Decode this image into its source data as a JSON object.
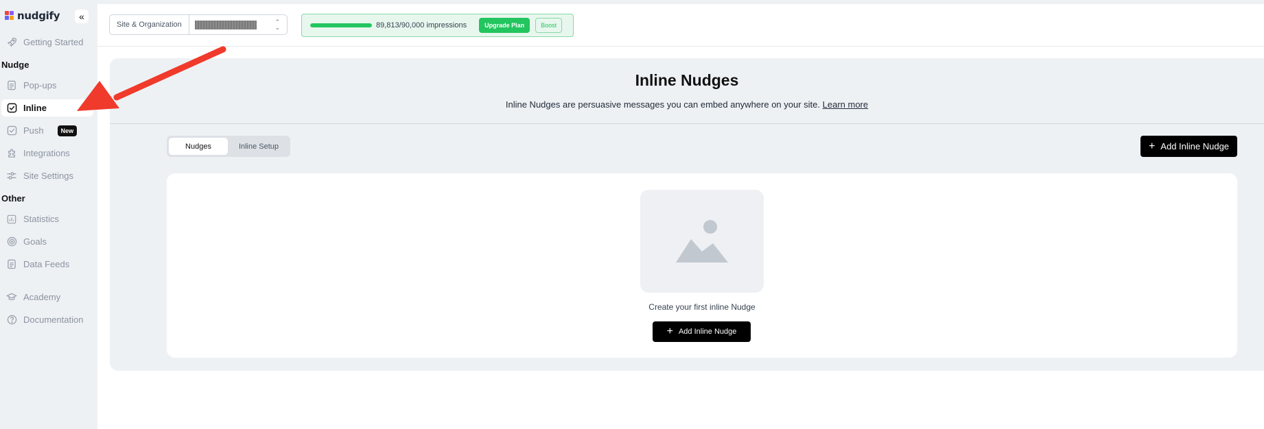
{
  "brand": {
    "name": "nudgify",
    "collapse_icon": "«"
  },
  "sidebar": {
    "getting_started": "Getting Started",
    "section_nudge": "Nudge",
    "popups": "Pop-ups",
    "inline": "Inline",
    "push": "Push",
    "push_badge": "New",
    "integrations": "Integrations",
    "site_settings": "Site Settings",
    "section_other": "Other",
    "statistics": "Statistics",
    "goals": "Goals",
    "data_feeds": "Data Feeds",
    "academy": "Academy",
    "documentation": "Documentation"
  },
  "topbar": {
    "site_select_label": "Site & Organization",
    "impressions_text": "89,813/90,000 impressions",
    "impressions_used": 89813,
    "impressions_limit": 90000,
    "upgrade_label": "Upgrade Plan",
    "boost_label": "Boost"
  },
  "main": {
    "title": "Inline Nudges",
    "subtitle": "Inline Nudges are persuasive messages you can embed anywhere on your site.",
    "learn_more": "Learn more",
    "tabs": [
      {
        "label": "Nudges",
        "active": true
      },
      {
        "label": "Inline Setup",
        "active": false
      }
    ],
    "add_button_label": "Add Inline Nudge",
    "empty_text": "Create your first inline Nudge",
    "empty_button_label": "Add Inline Nudge"
  },
  "colors": {
    "accent_green": "#22c55e",
    "annotation_arrow": "#f03a2b",
    "sidebar_bg": "#eef1f4"
  }
}
